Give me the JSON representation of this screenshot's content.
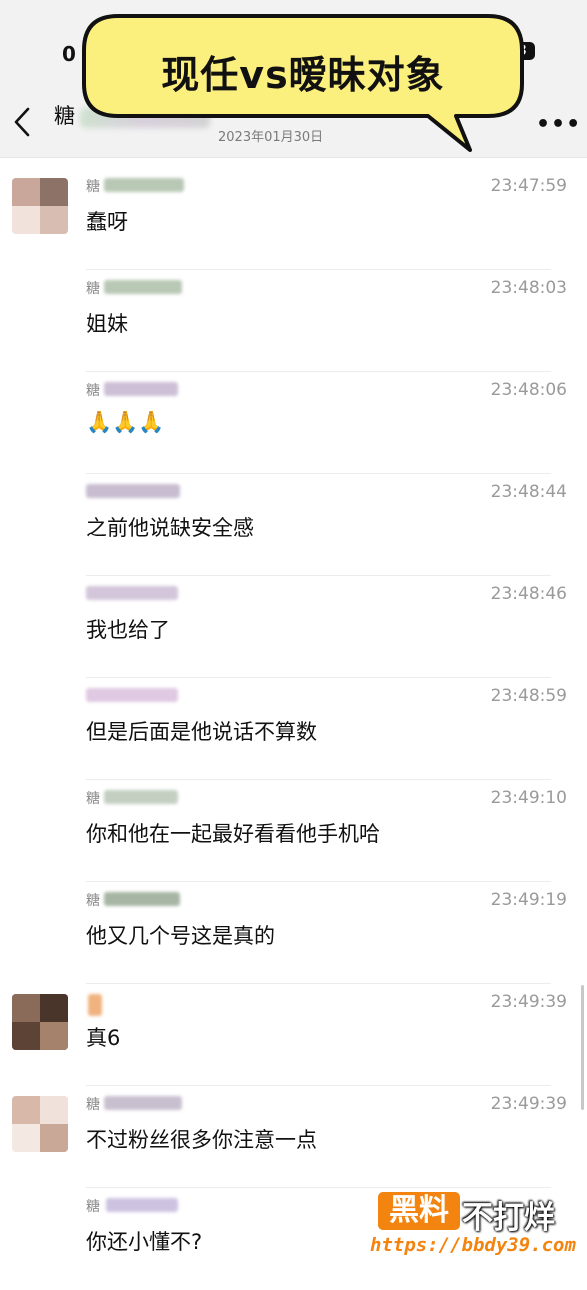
{
  "status": {
    "time": "0",
    "battery": "3"
  },
  "header": {
    "title": "糖",
    "date": "2023年01月30日",
    "more": "•••"
  },
  "banner": {
    "text": "现任vs暧昧对象"
  },
  "messages": [
    {
      "sender": "糖",
      "time": "23:47:59",
      "text": "蠢呀",
      "avatar": "a"
    },
    {
      "sender": "糖",
      "time": "23:48:03",
      "text": "姐妹",
      "avatar": ""
    },
    {
      "sender": "糖",
      "time": "23:48:06",
      "text": "🙏🙏🙏",
      "avatar": ""
    },
    {
      "sender": "",
      "time": "23:48:44",
      "text": "之前他说缺安全感",
      "avatar": ""
    },
    {
      "sender": "",
      "time": "23:48:46",
      "text": "我也给了",
      "avatar": ""
    },
    {
      "sender": "",
      "time": "23:48:59",
      "text": "但是后面是他说话不算数",
      "avatar": ""
    },
    {
      "sender": "糖",
      "time": "23:49:10",
      "text": "你和他在一起最好看看他手机哈",
      "avatar": ""
    },
    {
      "sender": "糖",
      "time": "23:49:19",
      "text": "他又几个号这是真的",
      "avatar": ""
    },
    {
      "sender": "",
      "time": "23:49:39",
      "text": "真6",
      "avatar": "b"
    },
    {
      "sender": "糖",
      "time": "23:49:39",
      "text": "不过粉丝很多你注意一点",
      "avatar": "c"
    },
    {
      "sender": "糖",
      "time": "",
      "text": "你还小懂不?",
      "avatar": ""
    }
  ],
  "watermark": {
    "brand_box": "黑料",
    "brand_text": "不打烊",
    "url": "https://bbdy39.com"
  }
}
